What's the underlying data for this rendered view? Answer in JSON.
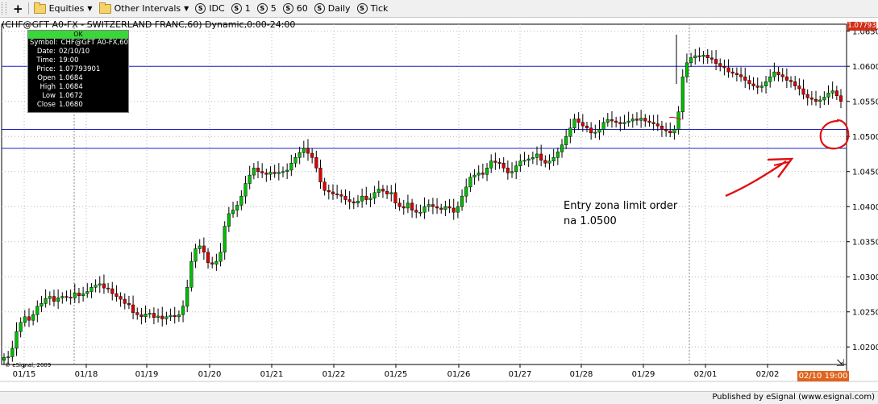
{
  "toolbar": {
    "equities": "Equities",
    "other_intervals": "Other Intervals",
    "idc": "IDC",
    "int1": "1",
    "int5": "5",
    "int60": "60",
    "daily": "Daily",
    "tick": "Tick"
  },
  "chart": {
    "title": "(CHF@GFT A0-FX - SWITZERLAND FRANC,60) Dynamic,0:00-24:00",
    "last_price_label": "1.07793",
    "current_time_label": "02/10 19:00",
    "watermark": "© eSignal, 2009",
    "status": "Published by eSignal (www.esignal.com)",
    "note_line1": "Entry zona limit order",
    "note_line2": "na 1.0500"
  },
  "databox": {
    "header": "OK",
    "symbol_label": "Symbol:",
    "symbol": "CHF@GFT A0-FX,60",
    "rows": [
      {
        "k": "Date:",
        "v": "02/10/10"
      },
      {
        "k": "Time:",
        "v": "19:00"
      },
      {
        "k": "Price:",
        "v": "1.07793901"
      },
      {
        "k": "Open",
        "v": "1.0684"
      },
      {
        "k": "High",
        "v": "1.0684"
      },
      {
        "k": "Low",
        "v": "1.0672"
      },
      {
        "k": "Close",
        "v": "1.0680"
      }
    ]
  },
  "chart_data": {
    "type": "candlestick",
    "y_ticks": [
      "1.0650",
      "1.0600",
      "1.0550",
      "1.0500",
      "1.0450",
      "1.0400",
      "1.0350",
      "1.0300",
      "1.0250",
      "1.0200"
    ],
    "x_ticks": [
      "01/15",
      "01/18",
      "01/19",
      "01/20",
      "01/21",
      "01/22",
      "01/25",
      "01/26",
      "01/27",
      "01/28",
      "01/29",
      "02/01",
      "02/02"
    ],
    "ylim": [
      1.0175,
      1.066
    ],
    "horizontal_lines": [
      1.06,
      1.051,
      1.0483
    ],
    "grid": "dotted",
    "colors": {
      "up": "#00c000",
      "down": "#e00000",
      "hline": "#2020c0",
      "annotation": "#e01010"
    },
    "candles": [
      1.0185,
      1.0186,
      1.0198,
      1.0222,
      1.0235,
      1.0243,
      1.0238,
      1.0246,
      1.0258,
      1.0262,
      1.0269,
      1.0272,
      1.0265,
      1.027,
      1.0272,
      1.0271,
      1.027,
      1.0277,
      1.0273,
      1.0276,
      1.0279,
      1.0285,
      1.0288,
      1.029,
      1.0284,
      1.0283,
      1.0276,
      1.0272,
      1.0268,
      1.0262,
      1.026,
      1.0249,
      1.0246,
      1.0243,
      1.0247,
      1.0248,
      1.0242,
      1.0244,
      1.024,
      1.0243,
      1.0245,
      1.0243,
      1.0246,
      1.0258,
      1.0285,
      1.0322,
      1.034,
      1.0344,
      1.0335,
      1.032,
      1.0318,
      1.0322,
      1.0335,
      1.0372,
      1.039,
      1.0395,
      1.0402,
      1.0415,
      1.0433,
      1.0445,
      1.0455,
      1.045,
      1.0448,
      1.0446,
      1.0449,
      1.0447,
      1.0449,
      1.045,
      1.0452,
      1.0462,
      1.047,
      1.0477,
      1.0483,
      1.0476,
      1.047,
      1.0455,
      1.0435,
      1.0423,
      1.0421,
      1.0418,
      1.0417,
      1.0415,
      1.041,
      1.0407,
      1.0405,
      1.0408,
      1.0415,
      1.041,
      1.0412,
      1.042,
      1.0425,
      1.0422,
      1.0418,
      1.042,
      1.0405,
      1.04,
      1.0398,
      1.0405,
      1.0395,
      1.0392,
      1.0392,
      1.04,
      1.0403,
      1.04,
      1.0398,
      1.0396,
      1.04,
      1.0398,
      1.0392,
      1.04,
      1.0415,
      1.0428,
      1.0442,
      1.0445,
      1.0448,
      1.0446,
      1.0455,
      1.0465,
      1.0463,
      1.0462,
      1.0455,
      1.0448,
      1.045,
      1.0458,
      1.0465,
      1.0466,
      1.0468,
      1.047,
      1.0475,
      1.0466,
      1.0462,
      1.0465,
      1.047,
      1.0478,
      1.0488,
      1.05,
      1.0512,
      1.0525,
      1.052,
      1.0515,
      1.0512,
      1.0505,
      1.0506,
      1.051,
      1.052,
      1.0524,
      1.0522,
      1.052,
      1.0518,
      1.052,
      1.0522,
      1.0525,
      1.0523,
      1.0526,
      1.0522,
      1.052,
      1.0518,
      1.0515,
      1.051,
      1.0508,
      1.0505,
      1.051,
      1.0535,
      1.0585,
      1.0605,
      1.0612,
      1.0615,
      1.0614,
      1.0616,
      1.0612,
      1.061,
      1.0604,
      1.06,
      1.0598,
      1.0592,
      1.059,
      1.0588,
      1.0585,
      1.058,
      1.0575,
      1.0572,
      1.057,
      1.0572,
      1.0578,
      1.0585,
      1.0592,
      1.0588,
      1.0585,
      1.058,
      1.0578,
      1.0572,
      1.0568,
      1.056,
      1.0555,
      1.0553,
      1.055,
      1.0552,
      1.0556,
      1.0562,
      1.0565,
      1.0558,
      1.055
    ]
  }
}
